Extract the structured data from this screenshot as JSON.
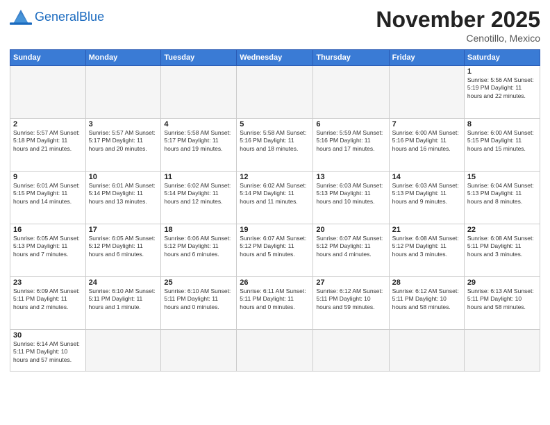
{
  "header": {
    "logo_general": "General",
    "logo_blue": "Blue",
    "month": "November 2025",
    "location": "Cenotillo, Mexico"
  },
  "weekdays": [
    "Sunday",
    "Monday",
    "Tuesday",
    "Wednesday",
    "Thursday",
    "Friday",
    "Saturday"
  ],
  "weeks": [
    [
      {
        "day": "",
        "info": ""
      },
      {
        "day": "",
        "info": ""
      },
      {
        "day": "",
        "info": ""
      },
      {
        "day": "",
        "info": ""
      },
      {
        "day": "",
        "info": ""
      },
      {
        "day": "",
        "info": ""
      },
      {
        "day": "1",
        "info": "Sunrise: 5:56 AM\nSunset: 5:19 PM\nDaylight: 11 hours\nand 22 minutes."
      }
    ],
    [
      {
        "day": "2",
        "info": "Sunrise: 5:57 AM\nSunset: 5:18 PM\nDaylight: 11 hours\nand 21 minutes."
      },
      {
        "day": "3",
        "info": "Sunrise: 5:57 AM\nSunset: 5:17 PM\nDaylight: 11 hours\nand 20 minutes."
      },
      {
        "day": "4",
        "info": "Sunrise: 5:58 AM\nSunset: 5:17 PM\nDaylight: 11 hours\nand 19 minutes."
      },
      {
        "day": "5",
        "info": "Sunrise: 5:58 AM\nSunset: 5:16 PM\nDaylight: 11 hours\nand 18 minutes."
      },
      {
        "day": "6",
        "info": "Sunrise: 5:59 AM\nSunset: 5:16 PM\nDaylight: 11 hours\nand 17 minutes."
      },
      {
        "day": "7",
        "info": "Sunrise: 6:00 AM\nSunset: 5:16 PM\nDaylight: 11 hours\nand 16 minutes."
      },
      {
        "day": "8",
        "info": "Sunrise: 6:00 AM\nSunset: 5:15 PM\nDaylight: 11 hours\nand 15 minutes."
      }
    ],
    [
      {
        "day": "9",
        "info": "Sunrise: 6:01 AM\nSunset: 5:15 PM\nDaylight: 11 hours\nand 14 minutes."
      },
      {
        "day": "10",
        "info": "Sunrise: 6:01 AM\nSunset: 5:14 PM\nDaylight: 11 hours\nand 13 minutes."
      },
      {
        "day": "11",
        "info": "Sunrise: 6:02 AM\nSunset: 5:14 PM\nDaylight: 11 hours\nand 12 minutes."
      },
      {
        "day": "12",
        "info": "Sunrise: 6:02 AM\nSunset: 5:14 PM\nDaylight: 11 hours\nand 11 minutes."
      },
      {
        "day": "13",
        "info": "Sunrise: 6:03 AM\nSunset: 5:13 PM\nDaylight: 11 hours\nand 10 minutes."
      },
      {
        "day": "14",
        "info": "Sunrise: 6:03 AM\nSunset: 5:13 PM\nDaylight: 11 hours\nand 9 minutes."
      },
      {
        "day": "15",
        "info": "Sunrise: 6:04 AM\nSunset: 5:13 PM\nDaylight: 11 hours\nand 8 minutes."
      }
    ],
    [
      {
        "day": "16",
        "info": "Sunrise: 6:05 AM\nSunset: 5:13 PM\nDaylight: 11 hours\nand 7 minutes."
      },
      {
        "day": "17",
        "info": "Sunrise: 6:05 AM\nSunset: 5:12 PM\nDaylight: 11 hours\nand 6 minutes."
      },
      {
        "day": "18",
        "info": "Sunrise: 6:06 AM\nSunset: 5:12 PM\nDaylight: 11 hours\nand 6 minutes."
      },
      {
        "day": "19",
        "info": "Sunrise: 6:07 AM\nSunset: 5:12 PM\nDaylight: 11 hours\nand 5 minutes."
      },
      {
        "day": "20",
        "info": "Sunrise: 6:07 AM\nSunset: 5:12 PM\nDaylight: 11 hours\nand 4 minutes."
      },
      {
        "day": "21",
        "info": "Sunrise: 6:08 AM\nSunset: 5:12 PM\nDaylight: 11 hours\nand 3 minutes."
      },
      {
        "day": "22",
        "info": "Sunrise: 6:08 AM\nSunset: 5:11 PM\nDaylight: 11 hours\nand 3 minutes."
      }
    ],
    [
      {
        "day": "23",
        "info": "Sunrise: 6:09 AM\nSunset: 5:11 PM\nDaylight: 11 hours\nand 2 minutes."
      },
      {
        "day": "24",
        "info": "Sunrise: 6:10 AM\nSunset: 5:11 PM\nDaylight: 11 hours\nand 1 minute."
      },
      {
        "day": "25",
        "info": "Sunrise: 6:10 AM\nSunset: 5:11 PM\nDaylight: 11 hours\nand 0 minutes."
      },
      {
        "day": "26",
        "info": "Sunrise: 6:11 AM\nSunset: 5:11 PM\nDaylight: 11 hours\nand 0 minutes."
      },
      {
        "day": "27",
        "info": "Sunrise: 6:12 AM\nSunset: 5:11 PM\nDaylight: 10 hours\nand 59 minutes."
      },
      {
        "day": "28",
        "info": "Sunrise: 6:12 AM\nSunset: 5:11 PM\nDaylight: 10 hours\nand 58 minutes."
      },
      {
        "day": "29",
        "info": "Sunrise: 6:13 AM\nSunset: 5:11 PM\nDaylight: 10 hours\nand 58 minutes."
      }
    ],
    [
      {
        "day": "30",
        "info": "Sunrise: 6:14 AM\nSunset: 5:11 PM\nDaylight: 10 hours\nand 57 minutes."
      },
      {
        "day": "",
        "info": ""
      },
      {
        "day": "",
        "info": ""
      },
      {
        "day": "",
        "info": ""
      },
      {
        "day": "",
        "info": ""
      },
      {
        "day": "",
        "info": ""
      },
      {
        "day": "",
        "info": ""
      }
    ]
  ]
}
